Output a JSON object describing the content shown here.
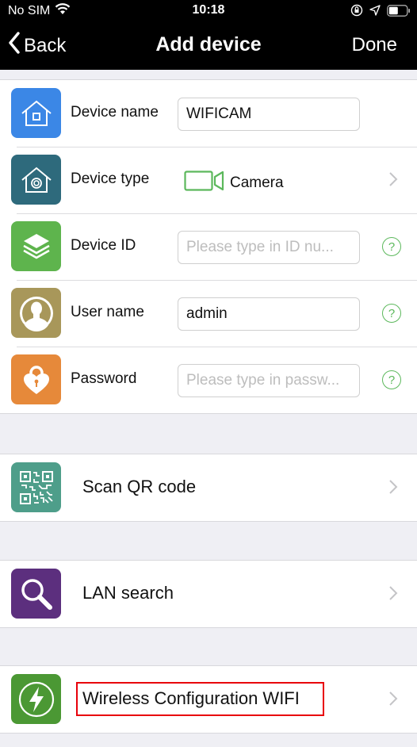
{
  "status_bar": {
    "carrier": "No SIM",
    "time": "10:18",
    "icons": [
      "wifi-icon",
      "orientation-lock-icon",
      "location-icon",
      "battery-icon"
    ]
  },
  "nav": {
    "back_label": "Back",
    "title": "Add device",
    "done_label": "Done"
  },
  "form": {
    "device_name": {
      "label": "Device name",
      "value": "WIFICAM",
      "icon": "house-icon",
      "icon_color": "#3b87e6"
    },
    "device_type": {
      "label": "Device type",
      "value": "Camera",
      "icon": "house-camera-icon",
      "icon_color": "#2e6a7c",
      "value_icon_color": "#5cb85c"
    },
    "device_id": {
      "label": "Device ID",
      "value": "",
      "placeholder": "Please type in ID nu...",
      "icon": "layers-icon",
      "icon_color": "#5eb44d"
    },
    "user_name": {
      "label": "User name",
      "value": "admin",
      "icon": "user-icon",
      "icon_color": "#a8975a"
    },
    "password": {
      "label": "Password",
      "value": "",
      "placeholder": "Please type in passw...",
      "icon": "heart-lock-icon",
      "icon_color": "#e6893a"
    },
    "help_glyph": "?"
  },
  "actions": [
    {
      "label": "Scan QR code",
      "icon": "qr-code-icon",
      "icon_color": "#4e9e8a"
    },
    {
      "label": "LAN search",
      "icon": "magnifier-icon",
      "icon_color": "#5c2f7e"
    },
    {
      "label": "Wireless Configuration WIFI",
      "icon": "lightning-icon",
      "icon_color": "#4b9834",
      "highlighted": true,
      "highlight_color": "#e8000b"
    }
  ]
}
